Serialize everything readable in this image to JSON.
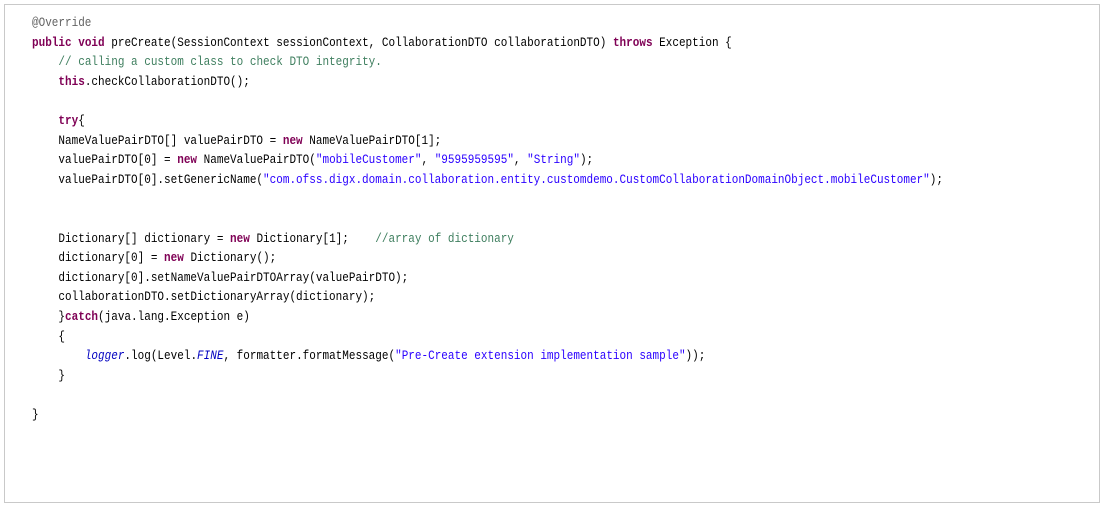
{
  "colors": {
    "keyword": "#7f0055",
    "comment": "#3f7f5f",
    "string": "#2a00ff",
    "annotation": "#646464",
    "field": "#0000c0",
    "plain": "#000000",
    "border": "#c9c9c9",
    "background": "#ffffff"
  },
  "code_lines": [
    [
      {
        "t": "annotation",
        "v": "@Override"
      }
    ],
    [
      {
        "t": "keyword",
        "v": "public"
      },
      {
        "t": "plain",
        "v": " "
      },
      {
        "t": "keyword",
        "v": "void"
      },
      {
        "t": "plain",
        "v": " preCreate(SessionContext sessionContext, CollaborationDTO collaborationDTO) "
      },
      {
        "t": "keyword",
        "v": "throws"
      },
      {
        "t": "plain",
        "v": " Exception {"
      }
    ],
    [
      {
        "t": "plain",
        "v": "    "
      },
      {
        "t": "comment",
        "v": "// calling a custom class to check DTO integrity."
      }
    ],
    [
      {
        "t": "plain",
        "v": "    "
      },
      {
        "t": "keyword",
        "v": "this"
      },
      {
        "t": "plain",
        "v": ".checkCollaborationDTO();"
      }
    ],
    [],
    [
      {
        "t": "plain",
        "v": "    "
      },
      {
        "t": "keyword",
        "v": "try"
      },
      {
        "t": "plain",
        "v": "{"
      }
    ],
    [
      {
        "t": "plain",
        "v": "    NameValuePairDTO[] valuePairDTO = "
      },
      {
        "t": "keyword",
        "v": "new"
      },
      {
        "t": "plain",
        "v": " NameValuePairDTO[1];"
      }
    ],
    [
      {
        "t": "plain",
        "v": "    valuePairDTO[0] = "
      },
      {
        "t": "keyword",
        "v": "new"
      },
      {
        "t": "plain",
        "v": " NameValuePairDTO("
      },
      {
        "t": "string",
        "v": "\"mobileCustomer\""
      },
      {
        "t": "plain",
        "v": ", "
      },
      {
        "t": "string",
        "v": "\"9595959595\""
      },
      {
        "t": "plain",
        "v": ", "
      },
      {
        "t": "string",
        "v": "\"String\""
      },
      {
        "t": "plain",
        "v": ");"
      }
    ],
    [
      {
        "t": "plain",
        "v": "    valuePairDTO[0].setGenericName("
      },
      {
        "t": "string",
        "v": "\"com.ofss.digx.domain.collaboration.entity.customdemo.CustomCollaborationDomainObject.mobileCustomer\""
      },
      {
        "t": "plain",
        "v": ");"
      }
    ],
    [],
    [],
    [
      {
        "t": "plain",
        "v": "    Dictionary[] dictionary = "
      },
      {
        "t": "keyword",
        "v": "new"
      },
      {
        "t": "plain",
        "v": " Dictionary[1];    "
      },
      {
        "t": "comment",
        "v": "//array of dictionary"
      }
    ],
    [
      {
        "t": "plain",
        "v": "    dictionary[0] = "
      },
      {
        "t": "keyword",
        "v": "new"
      },
      {
        "t": "plain",
        "v": " Dictionary();"
      }
    ],
    [
      {
        "t": "plain",
        "v": "    dictionary[0].setNameValuePairDTOArray(valuePairDTO);"
      }
    ],
    [
      {
        "t": "plain",
        "v": "    collaborationDTO.setDictionaryArray(dictionary);"
      }
    ],
    [
      {
        "t": "plain",
        "v": "    }"
      },
      {
        "t": "keyword",
        "v": "catch"
      },
      {
        "t": "plain",
        "v": "(java.lang.Exception e)"
      }
    ],
    [
      {
        "t": "plain",
        "v": "    {"
      }
    ],
    [
      {
        "t": "plain",
        "v": "        "
      },
      {
        "t": "field-italic",
        "v": "logger"
      },
      {
        "t": "plain",
        "v": ".log(Level."
      },
      {
        "t": "field-static",
        "v": "FINE"
      },
      {
        "t": "plain",
        "v": ", formatter.formatMessage("
      },
      {
        "t": "string",
        "v": "\"Pre-Create extension implementation sample\""
      },
      {
        "t": "plain",
        "v": "));"
      }
    ],
    [
      {
        "t": "plain",
        "v": "    }"
      }
    ],
    [],
    [
      {
        "t": "plain",
        "v": "}"
      }
    ]
  ]
}
